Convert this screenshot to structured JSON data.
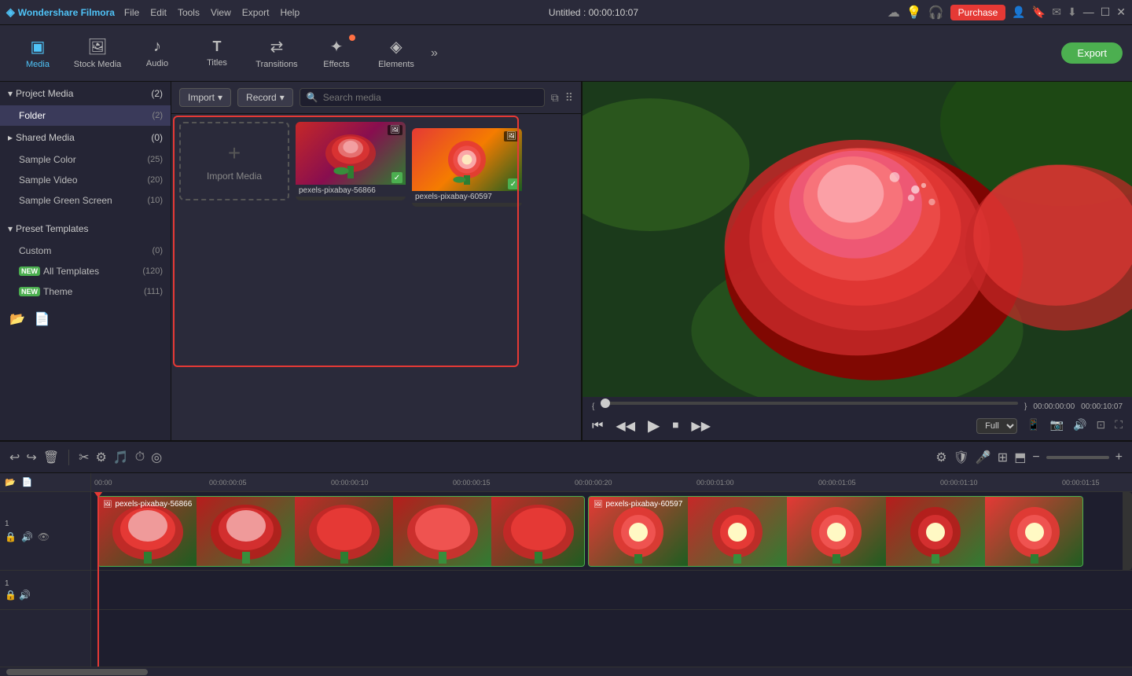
{
  "app": {
    "name": "Wondershare Filmora",
    "title": "Untitled : 00:00:10:07"
  },
  "titlebar": {
    "menu": [
      "File",
      "Edit",
      "Tools",
      "View",
      "Export",
      "Help"
    ],
    "purchase_label": "Purchase",
    "window_controls": [
      "—",
      "☐",
      "✕"
    ]
  },
  "toolbar": {
    "items": [
      {
        "id": "media",
        "label": "Media",
        "icon": "▣",
        "active": true
      },
      {
        "id": "stock-media",
        "label": "Stock Media",
        "icon": "🖼"
      },
      {
        "id": "audio",
        "label": "Audio",
        "icon": "♪"
      },
      {
        "id": "titles",
        "label": "Titles",
        "icon": "T"
      },
      {
        "id": "transitions",
        "label": "Transitions",
        "icon": "⇄"
      },
      {
        "id": "effects",
        "label": "Effects",
        "icon": "✦"
      },
      {
        "id": "elements",
        "label": "Elements",
        "icon": "◈"
      }
    ],
    "export_label": "Export"
  },
  "media_toolbar": {
    "import_label": "Import",
    "record_label": "Record",
    "search_placeholder": "Search media",
    "filter_icon": "⧉",
    "grid_icon": "⠿"
  },
  "sidebar": {
    "project_media": {
      "label": "Project Media",
      "count": "(2)",
      "expanded": true
    },
    "folder": {
      "label": "Folder",
      "count": "(2)"
    },
    "shared_media": {
      "label": "Shared Media",
      "count": "(0)",
      "expanded": false
    },
    "sample_color": {
      "label": "Sample Color",
      "count": "(25)"
    },
    "sample_video": {
      "label": "Sample Video",
      "count": "(20)"
    },
    "sample_green_screen": {
      "label": "Sample Green Screen",
      "count": "(10)"
    },
    "preset_templates": {
      "label": "Preset Templates",
      "expanded": true
    },
    "custom": {
      "label": "Custom",
      "count": "(0)"
    },
    "all_templates": {
      "label": "All Templates",
      "count": "(120)",
      "badge": "NEW"
    },
    "theme": {
      "label": "Theme",
      "count": "(111)",
      "badge": "NEW"
    }
  },
  "media_items": [
    {
      "id": "import",
      "type": "import",
      "label": "Import Media"
    },
    {
      "id": "pexels-56866",
      "type": "video",
      "label": "pexels-pixabay-56866",
      "checked": true
    },
    {
      "id": "pexels-60597",
      "type": "video",
      "label": "pexels-pixabay-60597",
      "checked": true
    }
  ],
  "timeline": {
    "timecodes": [
      "00:00",
      "00:00:00:05",
      "00:00:00:10",
      "00:00:00:15",
      "00:00:00:20",
      "00:00:01:00",
      "00:00:01:05",
      "00:00:01:10",
      "00:00:01:15"
    ],
    "track1_label": "pexels-pixabay-56866",
    "track2_label": "pexels-pixabay-60597"
  },
  "preview": {
    "current_time": "00:00:00:00",
    "total_time": "00:00:10:07",
    "quality": "Full",
    "bracket_start": "{",
    "bracket_end": "}"
  },
  "icons": {
    "logo_icon": "◈",
    "chevron_down": "▾",
    "chevron_right": "▸",
    "play": "▶",
    "pause": "⏸",
    "stop": "⏹",
    "prev": "⏮",
    "next": "⏭",
    "undo": "↩",
    "redo": "↪",
    "delete": "🗑",
    "cut": "✂",
    "adjust": "⚙",
    "zoom_in": "+",
    "zoom_out": "−",
    "search": "🔍",
    "filter": "⧉",
    "mic": "🎤",
    "lock": "🔒",
    "volume": "🔊",
    "eye": "👁",
    "screenshot": "📷",
    "fullscreen": "⛶",
    "crop": "⊡",
    "folder_add": "📂",
    "file_add": "📄"
  }
}
